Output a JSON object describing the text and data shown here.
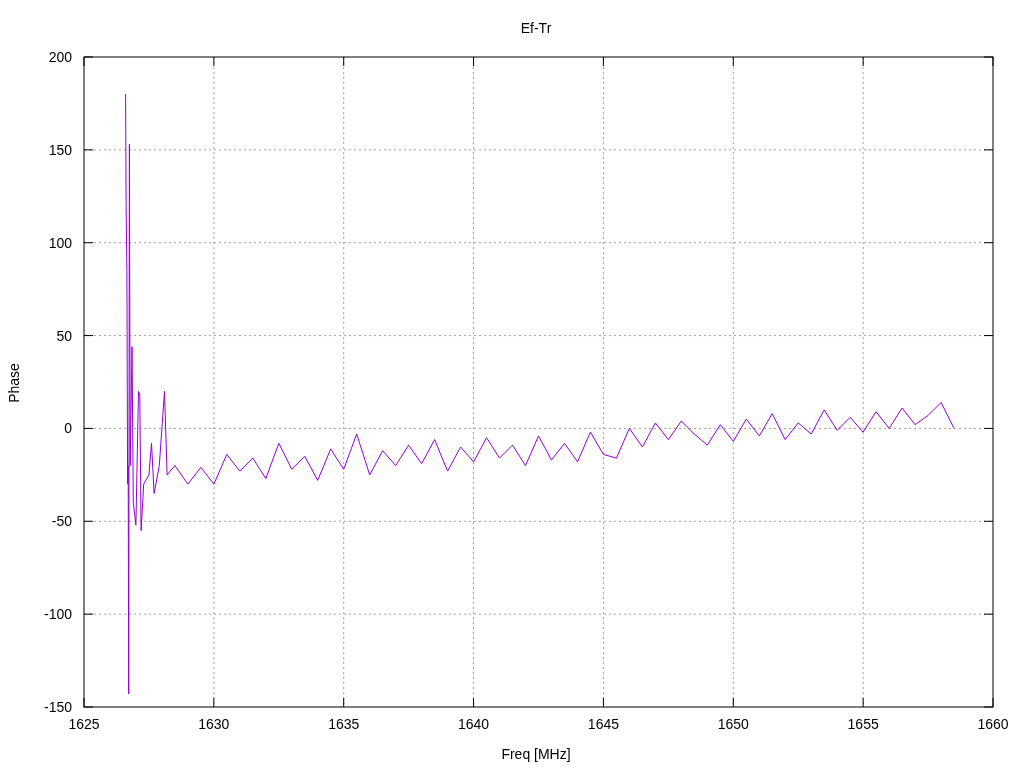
{
  "plot": {
    "chart_data": {
      "type": "line",
      "grid": true,
      "title": "Ef-Tr",
      "xlabel": "Freq [MHz]",
      "ylabel": "Phase",
      "xlim": [
        1625,
        1660
      ],
      "ylim": [
        -150,
        200
      ],
      "xticks": [
        1625,
        1630,
        1635,
        1640,
        1645,
        1650,
        1655,
        1660
      ],
      "yticks": [
        -150,
        -100,
        -50,
        0,
        50,
        100,
        150,
        200
      ],
      "x": [
        1626.6,
        1626.62,
        1626.65,
        1626.68,
        1626.7,
        1626.72,
        1626.75,
        1626.78,
        1626.85,
        1626.9,
        1627,
        1627.1,
        1627.15,
        1627.2,
        1627.3,
        1627.5,
        1627.6,
        1627.7,
        1627.9,
        1628.1,
        1628.2,
        1628.5,
        1629,
        1629.5,
        1630,
        1630.5,
        1631,
        1631.5,
        1632,
        1632.5,
        1633,
        1633.5,
        1634,
        1634.5,
        1635,
        1635.5,
        1636,
        1636.5,
        1637,
        1637.5,
        1638,
        1638.5,
        1639,
        1639.5,
        1640,
        1640.5,
        1641,
        1641.5,
        1642,
        1642.5,
        1643,
        1643.5,
        1644,
        1644.5,
        1645,
        1645.5,
        1646,
        1646.5,
        1647,
        1647.5,
        1648,
        1648.5,
        1649,
        1649.5,
        1650,
        1650.5,
        1651,
        1651.5,
        1652,
        1652.5,
        1653,
        1653.5,
        1654,
        1654.5,
        1655,
        1655.5,
        1656,
        1656.5,
        1657,
        1657.5,
        1658,
        1658.5
      ],
      "series": [
        {
          "color": "#9400d3",
          "values": [
            180,
            120,
            85,
            -30,
            -20,
            -143,
            153,
            -20,
            44,
            -40,
            -52,
            20,
            18,
            -55,
            -30,
            -25,
            -8,
            -35,
            -20,
            20,
            -25,
            -20,
            -30,
            -21,
            -30,
            -14,
            -23,
            -16,
            -27,
            -8,
            -22,
            -15,
            -28,
            -11,
            -22,
            -3,
            -25,
            -12,
            -20,
            -9,
            -19,
            -6,
            -23,
            -10,
            -18,
            -5,
            -16,
            -9,
            -20,
            -4,
            -17,
            -8,
            -18,
            -2,
            -14,
            -16,
            0,
            -10,
            3,
            -6,
            4,
            -3,
            -9,
            2,
            -7,
            5,
            -4,
            8,
            -6,
            3,
            -3,
            10,
            -1,
            6,
            -2,
            9,
            0,
            11,
            2,
            7,
            14,
            0
          ]
        }
      ]
    }
  }
}
